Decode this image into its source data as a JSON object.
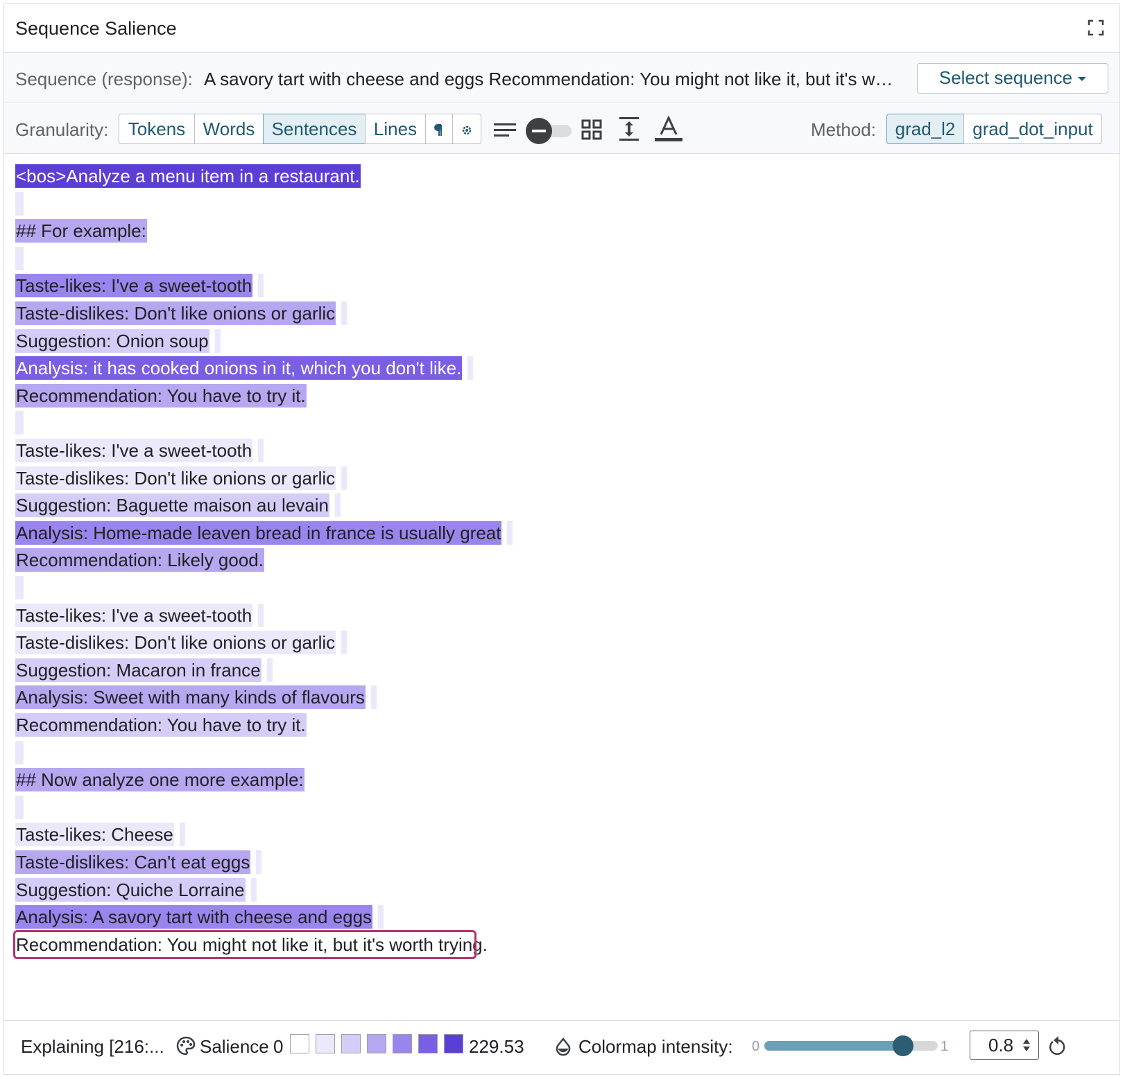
{
  "header": {
    "title": "Sequence Salience"
  },
  "sequence": {
    "label": "Sequence (response):",
    "value": "A savory tart with cheese and eggs Recommendation: You might not like it, but it's wo...",
    "select_button": "Select sequence"
  },
  "granularity": {
    "label": "Granularity:",
    "options": [
      "Tokens",
      "Words",
      "Sentences",
      "Lines"
    ],
    "selected": "Sentences"
  },
  "method": {
    "label": "Method:",
    "options": [
      "grad_l2",
      "grad_dot_input"
    ],
    "selected": "grad_l2"
  },
  "colors": {
    "accent": "#1e5a73",
    "target_border": "#b4316e",
    "level_1": "#ebe8fb",
    "level_2": "#d5cdf7",
    "level_3": "#b6a7f0",
    "level_4": "#9a85ec",
    "level_5": "#7a5ee3",
    "level_6": "#5b3fd5"
  },
  "lines": [
    {
      "text": "<bos>Analyze a menu item in a restaurant.",
      "level": 6,
      "trail": false
    },
    {
      "text": "",
      "level": 0
    },
    {
      "text": "## For example:",
      "level": 3,
      "trail": false
    },
    {
      "text": "",
      "level": 0
    },
    {
      "text": "Taste-likes: I've a sweet-tooth",
      "level": 4,
      "trail": true
    },
    {
      "text": "Taste-dislikes: Don't like onions or garlic",
      "level": 3,
      "trail": true
    },
    {
      "text": "Suggestion: Onion soup",
      "level": 2,
      "trail": true
    },
    {
      "text": "Analysis: it has cooked onions in it, which you don't like.",
      "level": 5,
      "trail": true
    },
    {
      "text": "Recommendation: You have to try it.",
      "level": 3,
      "trail": false
    },
    {
      "text": "",
      "level": 0
    },
    {
      "text": "Taste-likes: I've a sweet-tooth",
      "level": 1,
      "trail": true
    },
    {
      "text": "Taste-dislikes: Don't like onions or garlic",
      "level": 1,
      "trail": true
    },
    {
      "text": "Suggestion: Baguette maison au levain",
      "level": 2,
      "trail": true
    },
    {
      "text": "Analysis: Home-made leaven bread in france is usually great",
      "level": 4,
      "trail": true
    },
    {
      "text": "Recommendation: Likely good.",
      "level": 3,
      "trail": false
    },
    {
      "text": "",
      "level": 0
    },
    {
      "text": "Taste-likes: I've a sweet-tooth",
      "level": 1,
      "trail": true
    },
    {
      "text": "Taste-dislikes: Don't like onions or garlic",
      "level": 1,
      "trail": true
    },
    {
      "text": "Suggestion: Macaron in france",
      "level": 2,
      "trail": true
    },
    {
      "text": "Analysis: Sweet with many kinds of flavours",
      "level": 3,
      "trail": true
    },
    {
      "text": "Recommendation: You have to try it.",
      "level": 2,
      "trail": false
    },
    {
      "text": "",
      "level": 0
    },
    {
      "text": "## Now analyze one more example:",
      "level": 3,
      "trail": false
    },
    {
      "text": "",
      "level": 0
    },
    {
      "text": "Taste-likes: Cheese",
      "level": 1,
      "trail": true
    },
    {
      "text": "Taste-dislikes: Can't eat eggs",
      "level": 3,
      "trail": true
    },
    {
      "text": "Suggestion: Quiche Lorraine",
      "level": 2,
      "trail": true
    },
    {
      "text": "Analysis: A savory tart with cheese and eggs",
      "level": 4,
      "trail": true
    },
    {
      "text": "Recommendation: You might not like it, but it's worth trying.",
      "level": 0,
      "target": true
    }
  ],
  "footer": {
    "explaining": "Explaining [216:...",
    "salience_label": "Salience",
    "scale_min": "0",
    "scale_max": "229.53",
    "colormap_label": "Colormap intensity:",
    "slider_min": "0",
    "slider_max": "1",
    "intensity_value": "0.8",
    "intensity": 0.8
  }
}
